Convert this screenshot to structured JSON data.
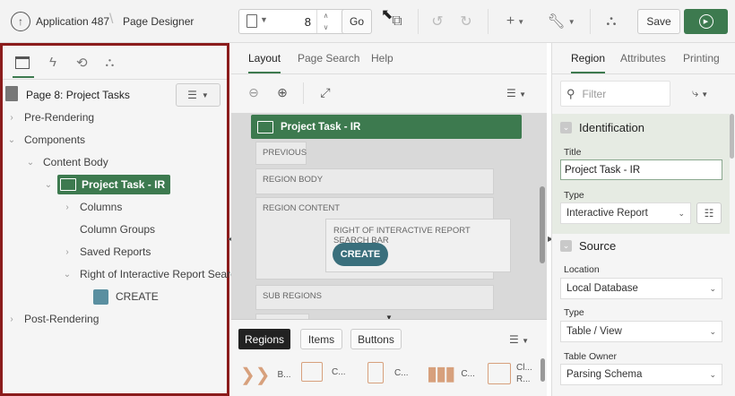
{
  "header": {
    "app_name": "Application 487",
    "page_designer": "Page Designer",
    "page_number": "8",
    "go_label": "Go",
    "save_label": "Save"
  },
  "left_panel": {
    "page_title": "Page 8: Project Tasks",
    "tree": [
      {
        "label": "Pre-Rendering"
      },
      {
        "label": "Components"
      },
      {
        "label": "Content Body"
      },
      {
        "label": "Project Task - IR"
      },
      {
        "label": "Columns"
      },
      {
        "label": "Column Groups"
      },
      {
        "label": "Saved Reports"
      },
      {
        "label": "Right of Interactive Report Search"
      },
      {
        "label": "CREATE"
      },
      {
        "label": "Post-Rendering"
      }
    ]
  },
  "center": {
    "tabs": [
      "Layout",
      "Page Search",
      "Help"
    ],
    "region_title": "Project Task - IR",
    "previous": "PREVIOUS",
    "region_body": "REGION BODY",
    "region_content": "REGION CONTENT",
    "right_of_search": "RIGHT OF INTERACTIVE REPORT SEARCH BAR",
    "create_button": "CREATE",
    "sub_regions": "SUB REGIONS",
    "gallery_tabs": [
      "Regions",
      "Items",
      "Buttons"
    ],
    "gallery_items": [
      "B...",
      "C...",
      "C...",
      "C...",
      "Cl...",
      "R..."
    ]
  },
  "right_panel": {
    "tabs": [
      "Region",
      "Attributes",
      "Printing"
    ],
    "filter_placeholder": "Filter",
    "identification": "Identification",
    "title_label": "Title",
    "title_value": "Project Task - IR",
    "type_label": "Type",
    "type_value": "Interactive Report",
    "source": "Source",
    "location_label": "Location",
    "location_value": "Local Database",
    "source_type_label": "Type",
    "source_type_value": "Table / View",
    "table_owner_label": "Table Owner",
    "table_owner_value": "Parsing Schema"
  },
  "colors": {
    "accent_green": "#3d7a4f",
    "highlight_border": "#8b1c1c",
    "create_button": "#3a6f7c"
  }
}
